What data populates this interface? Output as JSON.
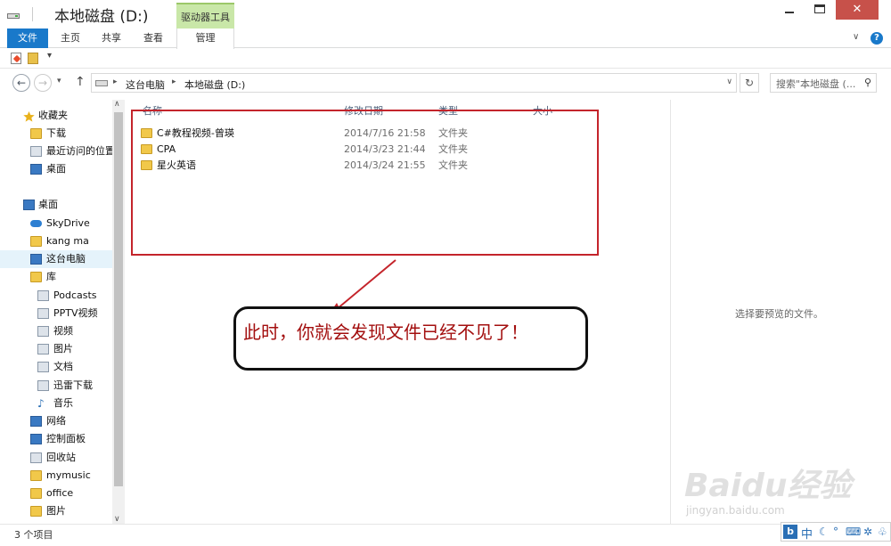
{
  "window": {
    "title": "本地磁盘 (D:)",
    "context_tab_group": "驱动器工具",
    "controls": {
      "minimize": "—",
      "maximize": "□",
      "close": "✕"
    }
  },
  "ribbon": {
    "tabs": [
      {
        "label": "文件"
      },
      {
        "label": "主页"
      },
      {
        "label": "共享"
      },
      {
        "label": "查看"
      },
      {
        "label": "管理"
      }
    ],
    "help_label": "?"
  },
  "address": {
    "path": [
      "这台电脑",
      "本地磁盘 (D:)"
    ],
    "search_placeholder": "搜索\"本地磁盘 (..."
  },
  "nav_pane": {
    "items": [
      {
        "label": "收藏夹",
        "icon": "star-icon"
      },
      {
        "label": "下载",
        "icon": "folder-icon"
      },
      {
        "label": "最近访问的位置",
        "icon": "recent-icon"
      },
      {
        "label": "桌面",
        "icon": "desktop-icon"
      },
      {
        "label": "桌面",
        "icon": "desktop-icon"
      },
      {
        "label": "SkyDrive",
        "icon": "cloud-icon"
      },
      {
        "label": "kang ma",
        "icon": "user-icon"
      },
      {
        "label": "这台电脑",
        "icon": "computer-icon"
      },
      {
        "label": "库",
        "icon": "library-icon"
      },
      {
        "label": "Podcasts",
        "icon": "podcast-icon"
      },
      {
        "label": "PPTV视频",
        "icon": "video-icon"
      },
      {
        "label": "视频",
        "icon": "video-icon"
      },
      {
        "label": "图片",
        "icon": "pictures-icon"
      },
      {
        "label": "文档",
        "icon": "document-icon"
      },
      {
        "label": "迅雷下载",
        "icon": "download-icon"
      },
      {
        "label": "音乐",
        "icon": "music-icon"
      },
      {
        "label": "网络",
        "icon": "network-icon"
      },
      {
        "label": "控制面板",
        "icon": "control-panel-icon"
      },
      {
        "label": "回收站",
        "icon": "recycle-bin-icon"
      },
      {
        "label": "mymusic",
        "icon": "folder-icon"
      },
      {
        "label": "office",
        "icon": "folder-icon"
      },
      {
        "label": "图片",
        "icon": "folder-icon"
      }
    ]
  },
  "file_list": {
    "columns": [
      "名称",
      "修改日期",
      "类型",
      "大小"
    ],
    "rows": [
      {
        "name": "C#教程视频-曾瑛",
        "modified": "2014/7/16 21:58",
        "type": "文件夹"
      },
      {
        "name": "CPA",
        "modified": "2014/3/23 21:44",
        "type": "文件夹"
      },
      {
        "name": "星火英语",
        "modified": "2014/3/24 21:55",
        "type": "文件夹"
      }
    ]
  },
  "preview_pane": {
    "message": "选择要预览的文件。"
  },
  "annotation": {
    "text": "此时，你就会发现文件已经不见了！"
  },
  "status": {
    "item_count": "3 个项目"
  },
  "watermark": {
    "logo": "Baidu经验",
    "url": "jingyan.baidu.com"
  },
  "ime": {
    "mode": "中"
  },
  "colors": {
    "file_tab": "#1979ca",
    "context_tab": "#c9e7a8",
    "close_button": "#c7514a",
    "annotation_border": "#c4242b",
    "annotation_text": "#a30f0f"
  }
}
